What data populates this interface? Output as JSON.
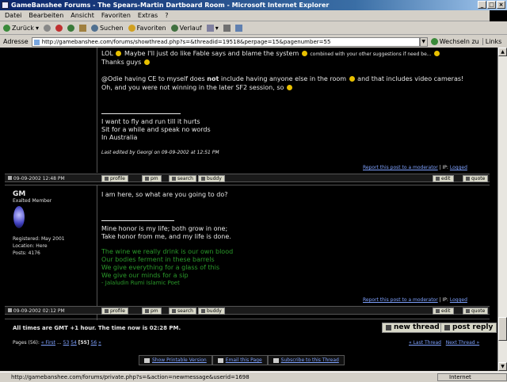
{
  "window": {
    "title": "GameBanshee Forums - The Spears-Martin Dartboard Room - Microsoft Internet Explorer"
  },
  "menu": [
    "Datei",
    "Bearbeiten",
    "Ansicht",
    "Favoriten",
    "Extras",
    "?"
  ],
  "toolbar": {
    "back": "Zurück",
    "search": "Suchen",
    "favorites": "Favoriten",
    "history": "Verlauf"
  },
  "address": {
    "label": "Adresse",
    "url": "http://gamebanshee.com/forums/showthread.php?s=&threadid=19518&perpage=15&pagenumber=55",
    "go": "Wechseln zu",
    "links": "Links"
  },
  "post1": {
    "lines": [
      "LOL",
      "Maybe I'll just do like Fable says and blame the system",
      "combined with your other suggestions if need be...",
      "Thanks guys",
      "@Odie having CE to myself does",
      "not",
      "include having anyone else in the room",
      "and that includes video cameras!",
      "Oh, and you were not winning in the later SF2 session, so"
    ],
    "sig": [
      "I want to fly and run till it hurts",
      "Sit for a while and speak no words",
      "In Australia"
    ],
    "edited": "Last edited by Georgi on 09-09-2002 at 12:51 PM",
    "date": "09-09-2002 12:48 PM",
    "report": "Report this post to a moderator",
    "ip": "IP:",
    "logged": "Logged"
  },
  "post2": {
    "user": "GM",
    "rank": "Exalted Member",
    "registered": "Registered: May 2001",
    "location": "Location: Here",
    "posts": "Posts: 4176",
    "text": "I am here, so what are you going to do?",
    "sig": [
      "Mine honor is my life; both grow in one;",
      "Take honor from me, and my life is done."
    ],
    "poem": [
      "The wine we really drink is our own blood",
      "Our bodies ferment in these barrels",
      "We give everything for a glass of this",
      "We give our minds for a sip",
      "- Jalaludin Rumi Islamic Poet"
    ],
    "date": "09-09-2002 02:12 PM",
    "report": "Report this post to a moderator",
    "ip": "IP:",
    "logged": "Logged"
  },
  "buttons": {
    "profile": "profile",
    "pm": "pm",
    "search": "search",
    "buddy": "buddy",
    "edit": "edit",
    "quote": "quote",
    "new_thread": "new thread",
    "post_reply": "post reply"
  },
  "footer": {
    "times": "All times are GMT +1 hour. The time now is 02:28 PM.",
    "pages_label": "Pages (56):",
    "first": "« First",
    "dots": "...",
    "p53": "53",
    "p54": "54",
    "p55": "[55]",
    "p56": "56",
    "next": "»",
    "last_thread": "« Last Thread",
    "next_thread": "Next Thread »",
    "printable": "Show Printable Version",
    "email": "Email this Page",
    "subscribe": "Subscribe to this Thread"
  },
  "status": {
    "url": "http://gamebanshee.com/forums/private.php?s=&action=newmessage&userid=1698",
    "zone": "Internet"
  }
}
